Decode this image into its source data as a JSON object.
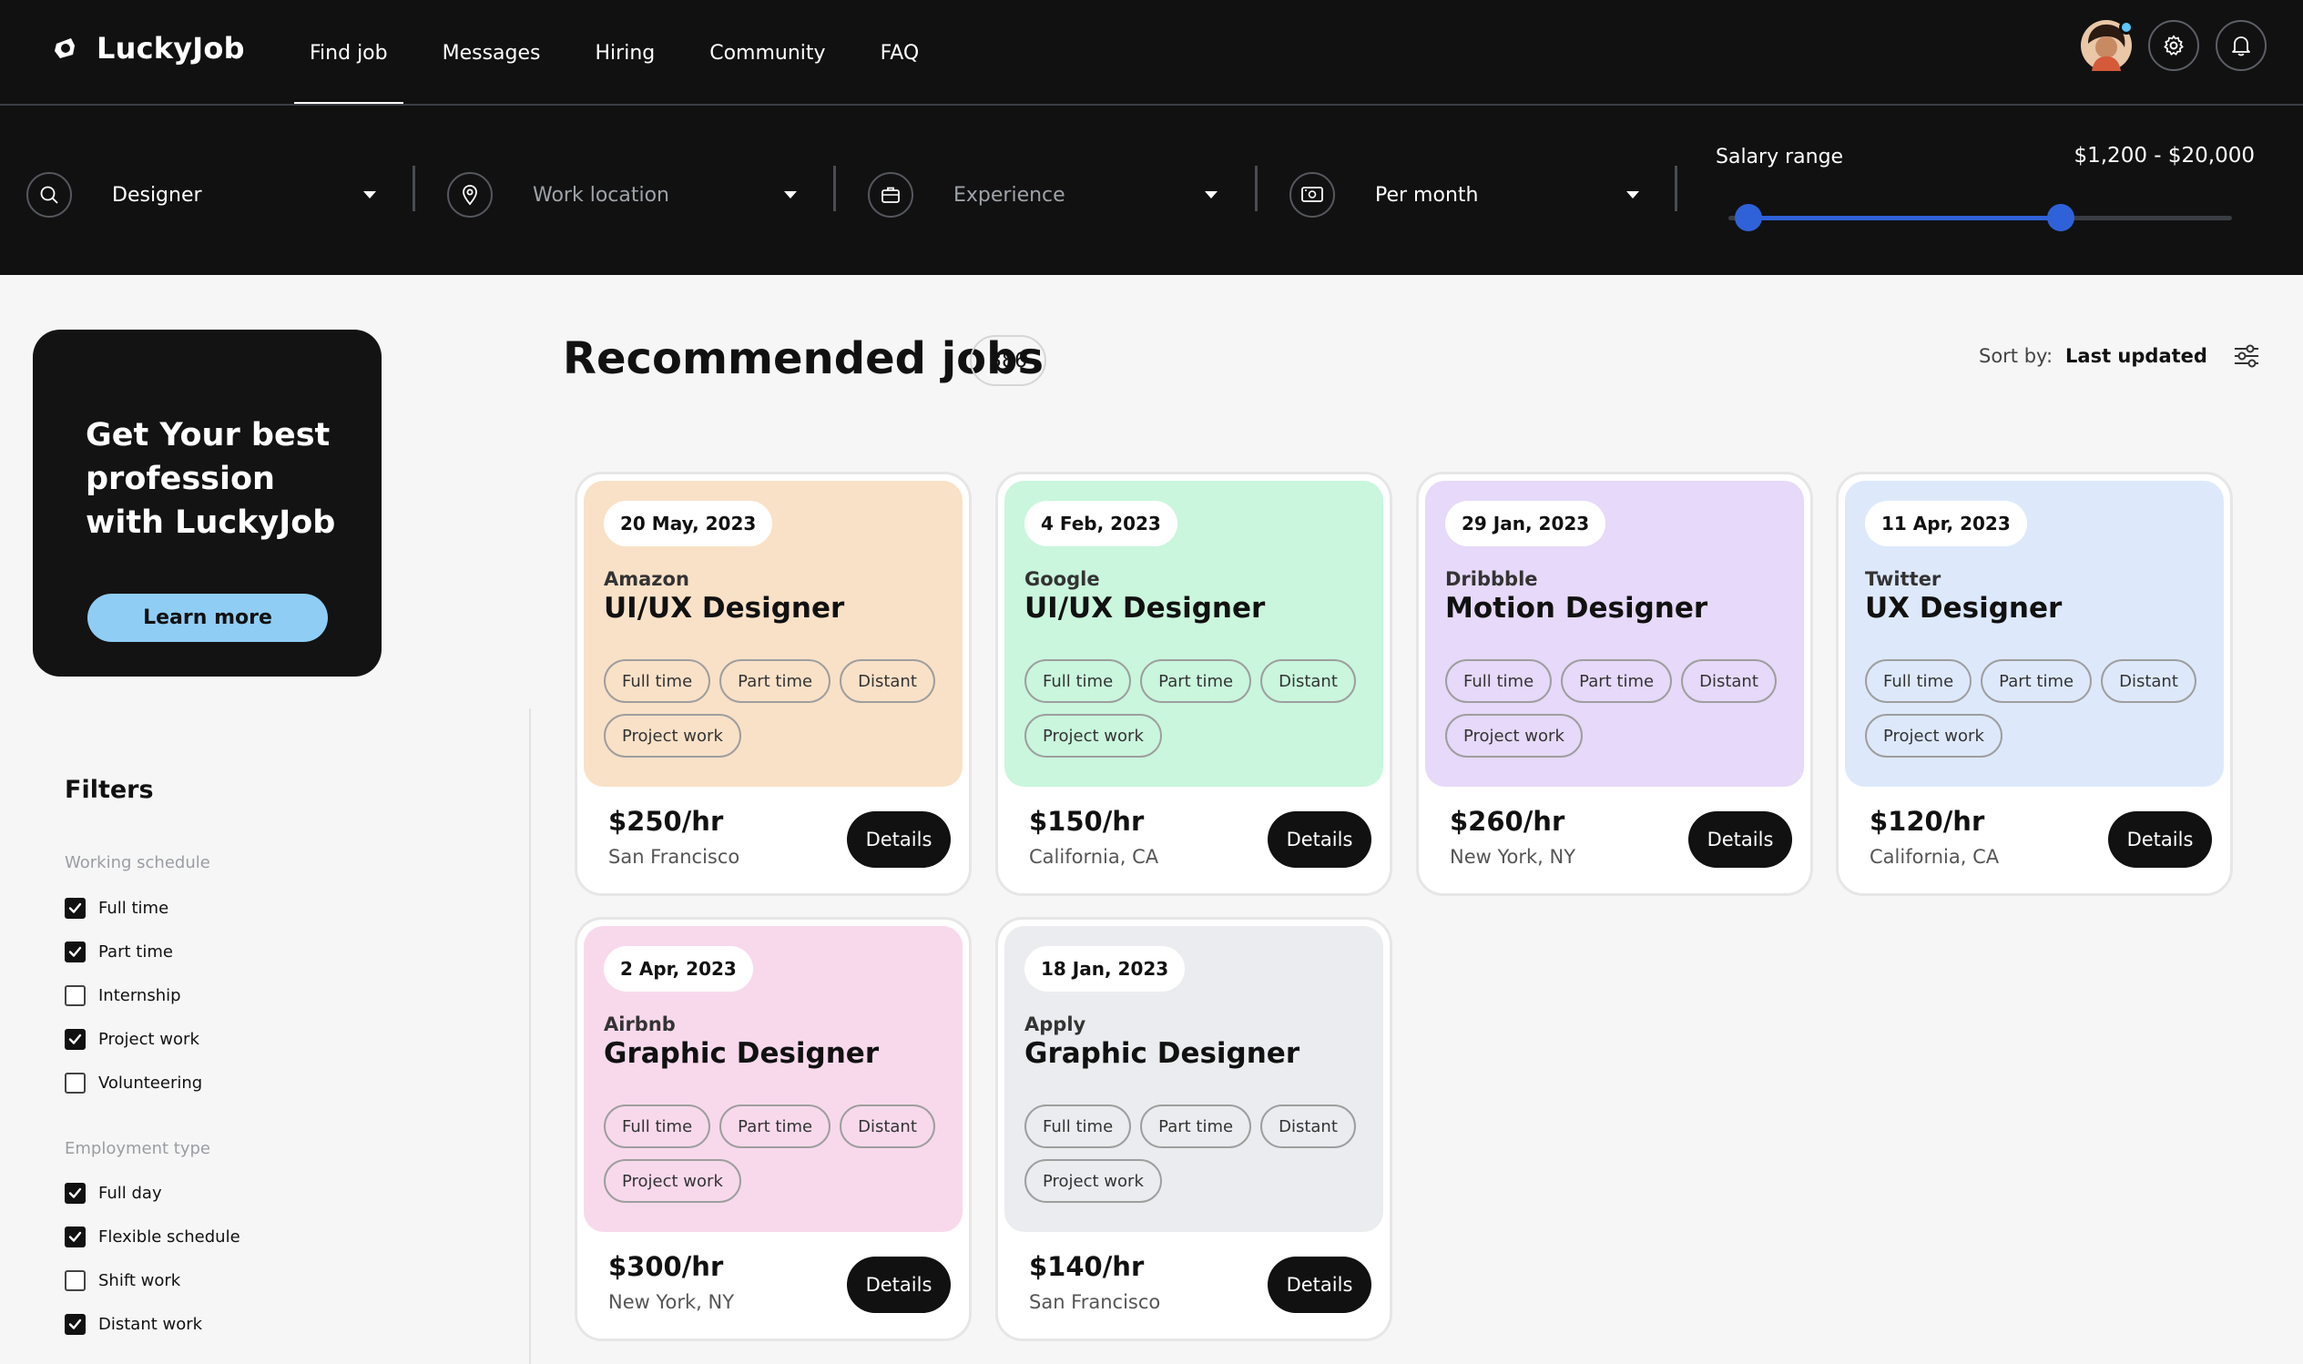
{
  "brand": {
    "name": "LuckyJob"
  },
  "nav": {
    "items": [
      "Find job",
      "Messages",
      "Hiring",
      "Community",
      "FAQ"
    ],
    "active_index": 0
  },
  "search": {
    "role": "Designer",
    "location_placeholder": "Work location",
    "experience_placeholder": "Experience",
    "period": "Per month",
    "salary_label": "Salary range",
    "salary_value": "$1,200 - $20,000",
    "slider_low_fraction": 0.04,
    "slider_high_fraction": 0.66
  },
  "promo": {
    "title": "Get Your best profession with LuckyJob",
    "button": "Learn more"
  },
  "filters": {
    "title": "Filters",
    "groups": [
      {
        "title": "Working schedule",
        "items": [
          {
            "label": "Full time",
            "checked": true
          },
          {
            "label": "Part time",
            "checked": true
          },
          {
            "label": "Internship",
            "checked": false
          },
          {
            "label": "Project work",
            "checked": true
          },
          {
            "label": "Volunteering",
            "checked": false
          }
        ]
      },
      {
        "title": "Employment type",
        "items": [
          {
            "label": "Full day",
            "checked": true
          },
          {
            "label": "Flexible schedule",
            "checked": true
          },
          {
            "label": "Shift work",
            "checked": false
          },
          {
            "label": "Distant work",
            "checked": true
          }
        ]
      }
    ]
  },
  "main": {
    "title": "Recommended jobs",
    "count": "386",
    "sort_label": "Sort by:",
    "sort_value": "Last updated"
  },
  "jobs": [
    {
      "date": "20 May, 2023",
      "company": "Amazon",
      "role": "UI/UX Designer",
      "tags": [
        "Full time",
        "Part time",
        "Distant",
        "Project work"
      ],
      "rate": "$250/hr",
      "location": "San Francisco",
      "button": "Details",
      "color": "#f9e1c7"
    },
    {
      "date": "4 Feb, 2023",
      "company": "Google",
      "role": "UI/UX Designer",
      "tags": [
        "Full time",
        "Part time",
        "Distant",
        "Project work"
      ],
      "rate": "$150/hr",
      "location": "California, CA",
      "button": "Details",
      "color": "#c9f6dd"
    },
    {
      "date": "29 Jan, 2023",
      "company": "Dribbble",
      "role": "Motion Designer",
      "tags": [
        "Full time",
        "Part time",
        "Distant",
        "Project work"
      ],
      "rate": "$260/hr",
      "location": "New York, NY",
      "button": "Details",
      "color": "#e6d9f9"
    },
    {
      "date": "11 Apr, 2023",
      "company": "Twitter",
      "role": "UX Designer",
      "tags": [
        "Full time",
        "Part time",
        "Distant",
        "Project work"
      ],
      "rate": "$120/hr",
      "location": "California, CA",
      "button": "Details",
      "color": "#dde9fb"
    },
    {
      "date": "2 Apr, 2023",
      "company": "Airbnb",
      "role": "Graphic Designer",
      "tags": [
        "Full time",
        "Part time",
        "Distant",
        "Project work"
      ],
      "rate": "$300/hr",
      "location": "New York, NY",
      "button": "Details",
      "color": "#f8d9ec"
    },
    {
      "date": "18 Jan, 2023",
      "company": "Apply",
      "role": "Graphic Designer",
      "tags": [
        "Full time",
        "Part time",
        "Distant",
        "Project work"
      ],
      "rate": "$140/hr",
      "location": "San Francisco",
      "button": "Details",
      "color": "#ebecef"
    }
  ]
}
